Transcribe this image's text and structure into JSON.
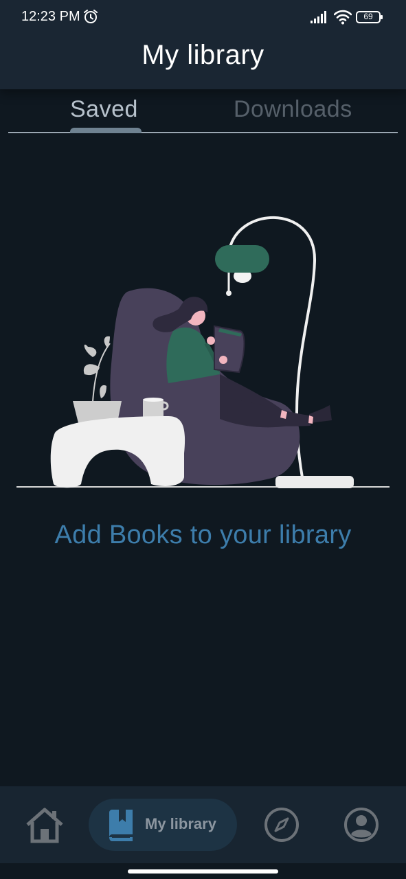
{
  "status_bar": {
    "time": "12:23 PM",
    "battery": "69",
    "icons": [
      "alarm-icon",
      "signal-icon",
      "wifi-icon",
      "battery-icon"
    ]
  },
  "header": {
    "title": "My library"
  },
  "tabs": [
    {
      "label": "Saved",
      "selected": true
    },
    {
      "label": "Downloads",
      "selected": false
    }
  ],
  "empty_state": {
    "message": "Add Books to your library",
    "illustration": "woman-reading-on-beanbag-illustration"
  },
  "bottom_nav": {
    "items": [
      {
        "icon": "home-icon",
        "label": ""
      },
      {
        "icon": "book-bookmark-icon",
        "label": "My library",
        "active": true
      },
      {
        "icon": "compass-icon",
        "label": ""
      },
      {
        "icon": "profile-icon",
        "label": ""
      }
    ]
  },
  "colors": {
    "background": "#0f1820",
    "header": "#1a2633",
    "accent": "#3d7dab",
    "nav_active_pill": "#1d3344"
  }
}
